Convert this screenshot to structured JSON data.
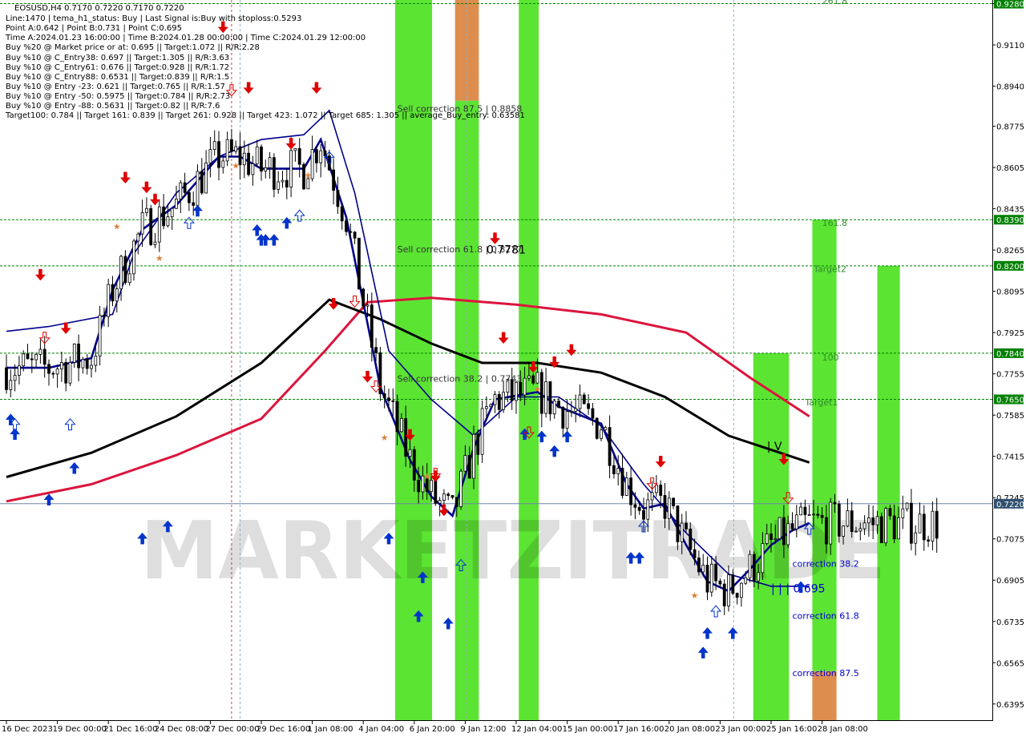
{
  "header": {
    "lines": [
      "EOSUSD,H4  0.7170 0.7220 0.7170 0.7220",
      "Line:1470 | tema_h1_status: Buy | Last Signal is:Buy with stoploss:0.5293",
      "Point A:0.642 | Point B:0.731 | Point C:0.695",
      "Time A:2024.01.23 16:00:00 | Time B:2024.01.28 00:00:00 | Time C:2024.01.29 12:00:00",
      "Buy %20 @ Market price or at: 0.695 || Target:1.072 || R/R:2.28",
      "Buy %10 @ C_Entry38: 0.697 || Target:1.305 || R/R:3.63",
      "Buy %10 @ C_Entry61: 0.676 || Target:0.928 || R/R:1.72",
      "Buy %10 @ C_Entry88: 0.6531 || Target:0.839 || R/R:1.5",
      "Buy %10 @ Entry -23: 0.621 || Target:0.765 || R/R:1.57",
      "Buy %10 @ Entry -50: 0.5975 || Target:0.784 || R/R:2.73",
      "Buy %10 @ Entry -88: 0.5631 || Target:0.82 || R/R:7.6",
      "Target100: 0.784 || Target 161: 0.839 || Target 261: 0.928 || Target 423: 1.072 || Target 685: 1.305 || average_Buy_entry: 0.63581"
    ]
  },
  "watermark": "MARKETZITRADE",
  "colors": {
    "bg": "#ffffff",
    "up": "#000000",
    "down": "#000000",
    "ema_red": "#dc143c",
    "ema_black": "#000000",
    "navy": "#00008b",
    "zone_green": "#33dd00",
    "zone_orange": "#d9823c",
    "hline_green": "#008000",
    "price_bg": "#008000",
    "current_price_bg": "#2f4f6f",
    "arrow_buy": "#0033cc",
    "arrow_sell": "#e00000"
  },
  "chart_data": {
    "type": "candlestick",
    "symbol": "EOSUSD",
    "timeframe": "H4",
    "ylim": [
      0.6325,
      0.9295
    ],
    "current_price": 0.722,
    "y_ticks": [
      "0.9280",
      "0.9110",
      "0.8940",
      "0.8775",
      "0.8605",
      "0.8435",
      "0.8265",
      "0.8095",
      "0.7925",
      "0.7755",
      "0.7585",
      "0.7415",
      "0.7245",
      "0.7075",
      "0.6905",
      "0.6735",
      "0.6565",
      "0.6395"
    ],
    "x_ticks": [
      "16 Dec 2023",
      "19 Dec 00:00",
      "21 Dec 16:00",
      "24 Dec 08:00",
      "27 Dec 00:00",
      "29 Dec 16:00",
      "1 Jan 08:00",
      "4 Jan 04:00",
      "6 Jan 20:00",
      "9 Jan 12:00",
      "12 Jan 04:00",
      "15 Jan 00:00",
      "17 Jan 16:00",
      "20 Jan 08:00",
      "23 Jan 00:00",
      "25 Jan 16:00",
      "28 Jan 08:00"
    ],
    "hlines": [
      {
        "price": 0.928,
        "label": "0.9280"
      },
      {
        "price": 0.839,
        "label": "0.8390"
      },
      {
        "price": 0.82,
        "label": "0.8200"
      },
      {
        "price": 0.784,
        "label": "0.7840"
      },
      {
        "price": 0.765,
        "label": "0.7650"
      }
    ],
    "level_labels": [
      {
        "text": "261.8",
        "price": 0.9278,
        "bar": 192
      },
      {
        "text": "161.8",
        "price": 0.8365,
        "bar": 192
      },
      {
        "text": "Target2",
        "price": 0.8175,
        "bar": 190
      },
      {
        "text": "100",
        "price": 0.781,
        "bar": 192
      },
      {
        "text": "Target1",
        "price": 0.7625,
        "bar": 188
      },
      {
        "text": "Sell correction 87.5 | 0.8858",
        "price": 0.8835,
        "bar": 92
      },
      {
        "text": "Sell correction 61.8 | 0.8277",
        "price": 0.8255,
        "bar": 92
      },
      {
        "text": "Sell correction 38.2 | 0.7743",
        "price": 0.7722,
        "bar": 92
      },
      {
        "text": "correction 38.2",
        "price": 0.696,
        "bar": 185
      },
      {
        "text": "correction 61.8",
        "price": 0.6745,
        "bar": 185
      },
      {
        "text": "correction 87.5",
        "price": 0.651,
        "bar": 185
      }
    ],
    "big_labels": [
      {
        "text": "0.7781",
        "price": 0.825,
        "bar": 113
      },
      {
        "text": "| V",
        "price": 0.744,
        "bar": 179
      },
      {
        "text": "| | | 0.695",
        "price": 0.6855,
        "bar": 180
      }
    ],
    "zones": [
      {
        "bar0": 91.5,
        "bar1": 100.2,
        "top": 0.9295,
        "bottom": 0.6325,
        "color": "green"
      },
      {
        "bar0": 105.6,
        "bar1": 111.2,
        "top": 0.9295,
        "bottom": 0.888,
        "color": "orange"
      },
      {
        "bar0": 105.6,
        "bar1": 111.2,
        "top": 0.888,
        "bottom": 0.6325,
        "color": "green"
      },
      {
        "bar0": 120.6,
        "bar1": 125.3,
        "top": 0.9295,
        "bottom": 0.6325,
        "color": "green"
      },
      {
        "bar0": 175.8,
        "bar1": 184.2,
        "top": 0.784,
        "bottom": 0.6325,
        "color": "green"
      },
      {
        "bar0": 189.7,
        "bar1": 195.4,
        "top": 0.839,
        "bottom": 0.653,
        "color": "green"
      },
      {
        "bar0": 189.7,
        "bar1": 195.4,
        "top": 0.653,
        "bottom": 0.6325,
        "color": "orange"
      },
      {
        "bar0": 205.0,
        "bar1": 210.3,
        "top": 0.82,
        "bottom": 0.6325,
        "color": "green"
      }
    ],
    "ema_red": [
      [
        0,
        0.723
      ],
      [
        20,
        0.73
      ],
      [
        40,
        0.742
      ],
      [
        60,
        0.757
      ],
      [
        75,
        0.785
      ],
      [
        85,
        0.805
      ],
      [
        100,
        0.8068
      ],
      [
        120,
        0.804
      ],
      [
        140,
        0.8
      ],
      [
        160,
        0.7925
      ],
      [
        175,
        0.774
      ],
      [
        189,
        0.758
      ]
    ],
    "ema_black": [
      [
        0,
        0.733
      ],
      [
        20,
        0.743
      ],
      [
        40,
        0.758
      ],
      [
        60,
        0.78
      ],
      [
        76,
        0.806
      ],
      [
        88,
        0.798
      ],
      [
        100,
        0.788
      ],
      [
        112,
        0.78
      ],
      [
        125,
        0.78
      ],
      [
        140,
        0.776
      ],
      [
        155,
        0.766
      ],
      [
        170,
        0.75
      ],
      [
        189,
        0.739
      ]
    ],
    "navy_ma1": [
      [
        0,
        0.793
      ],
      [
        10,
        0.795
      ],
      [
        25,
        0.8
      ],
      [
        30,
        0.825
      ],
      [
        40,
        0.85
      ],
      [
        50,
        0.865
      ],
      [
        60,
        0.872
      ],
      [
        70,
        0.874
      ],
      [
        76,
        0.884
      ],
      [
        82,
        0.85
      ],
      [
        90,
        0.785
      ],
      [
        100,
        0.765
      ],
      [
        110,
        0.75
      ],
      [
        120,
        0.766
      ],
      [
        130,
        0.766
      ],
      [
        140,
        0.754
      ],
      [
        150,
        0.73
      ],
      [
        160,
        0.71
      ],
      [
        170,
        0.693
      ],
      [
        180,
        0.688
      ],
      [
        189,
        0.688
      ]
    ],
    "navy_ma2": [
      [
        0,
        0.778
      ],
      [
        10,
        0.778
      ],
      [
        20,
        0.782
      ],
      [
        25,
        0.81
      ],
      [
        32,
        0.835
      ],
      [
        40,
        0.845
      ],
      [
        50,
        0.865
      ],
      [
        55,
        0.865
      ],
      [
        60,
        0.86
      ],
      [
        70,
        0.86
      ],
      [
        74,
        0.872
      ],
      [
        80,
        0.84
      ],
      [
        88,
        0.77
      ],
      [
        95,
        0.74
      ],
      [
        100,
        0.725
      ],
      [
        105,
        0.717
      ],
      [
        110,
        0.745
      ],
      [
        115,
        0.765
      ],
      [
        125,
        0.768
      ],
      [
        130,
        0.762
      ],
      [
        140,
        0.755
      ],
      [
        146,
        0.73
      ],
      [
        150,
        0.72
      ],
      [
        155,
        0.722
      ],
      [
        160,
        0.705
      ],
      [
        165,
        0.69
      ],
      [
        170,
        0.686
      ],
      [
        175,
        0.695
      ],
      [
        180,
        0.705
      ],
      [
        185,
        0.711
      ],
      [
        189,
        0.714
      ]
    ],
    "buy_arrows": [
      [
        1,
        0.759
      ],
      [
        2,
        0.753
      ],
      [
        10,
        0.726
      ],
      [
        16,
        0.739
      ],
      [
        32,
        0.71
      ],
      [
        38,
        0.715
      ],
      [
        45,
        0.845
      ],
      [
        59,
        0.837
      ],
      [
        60,
        0.833
      ],
      [
        61,
        0.833
      ],
      [
        63,
        0.833
      ],
      [
        66,
        0.84
      ],
      [
        90,
        0.71
      ],
      [
        97,
        0.678
      ],
      [
        98,
        0.694
      ],
      [
        104,
        0.675
      ],
      [
        122,
        0.753
      ],
      [
        126,
        0.752
      ],
      [
        129,
        0.746
      ],
      [
        132,
        0.752
      ],
      [
        147,
        0.702
      ],
      [
        149,
        0.702
      ],
      [
        164,
        0.663
      ],
      [
        165,
        0.671
      ],
      [
        171,
        0.671
      ],
      [
        187,
        0.69
      ]
    ],
    "sell_arrows": [
      [
        8,
        0.814
      ],
      [
        14,
        0.792
      ],
      [
        28,
        0.854
      ],
      [
        33,
        0.85
      ],
      [
        35,
        0.845
      ],
      [
        51,
        0.916
      ],
      [
        57,
        0.891
      ],
      [
        67,
        0.868
      ],
      [
        73,
        0.891
      ],
      [
        77,
        0.802
      ],
      [
        85,
        0.772
      ],
      [
        95,
        0.748
      ],
      [
        101,
        0.731
      ],
      [
        103,
        0.717
      ],
      [
        115,
        0.829
      ],
      [
        117,
        0.788
      ],
      [
        124,
        0.776
      ],
      [
        129,
        0.778
      ],
      [
        133,
        0.783
      ],
      [
        154,
        0.737
      ],
      [
        183,
        0.738
      ]
    ],
    "buy_hollow": [
      [
        2,
        0.757
      ],
      [
        15,
        0.757
      ],
      [
        43,
        0.84
      ],
      [
        69,
        0.843
      ],
      [
        76,
        0.867
      ],
      [
        107,
        0.699
      ],
      [
        150,
        0.715
      ],
      [
        167,
        0.68
      ],
      [
        189,
        0.714
      ]
    ],
    "sell_hollow": [
      [
        9,
        0.788
      ],
      [
        53,
        0.89
      ],
      [
        82,
        0.803
      ],
      [
        87,
        0.768
      ],
      [
        101,
        0.732
      ],
      [
        123,
        0.749
      ],
      [
        152,
        0.728
      ],
      [
        184,
        0.722
      ]
    ],
    "star_marks": [
      [
        26,
        0.835
      ],
      [
        36,
        0.822
      ],
      [
        54,
        0.86
      ],
      [
        71,
        0.856
      ],
      [
        89,
        0.748
      ],
      [
        99,
        0.732
      ],
      [
        125,
        0.768
      ],
      [
        162,
        0.683
      ]
    ],
    "ohlc": []
  }
}
